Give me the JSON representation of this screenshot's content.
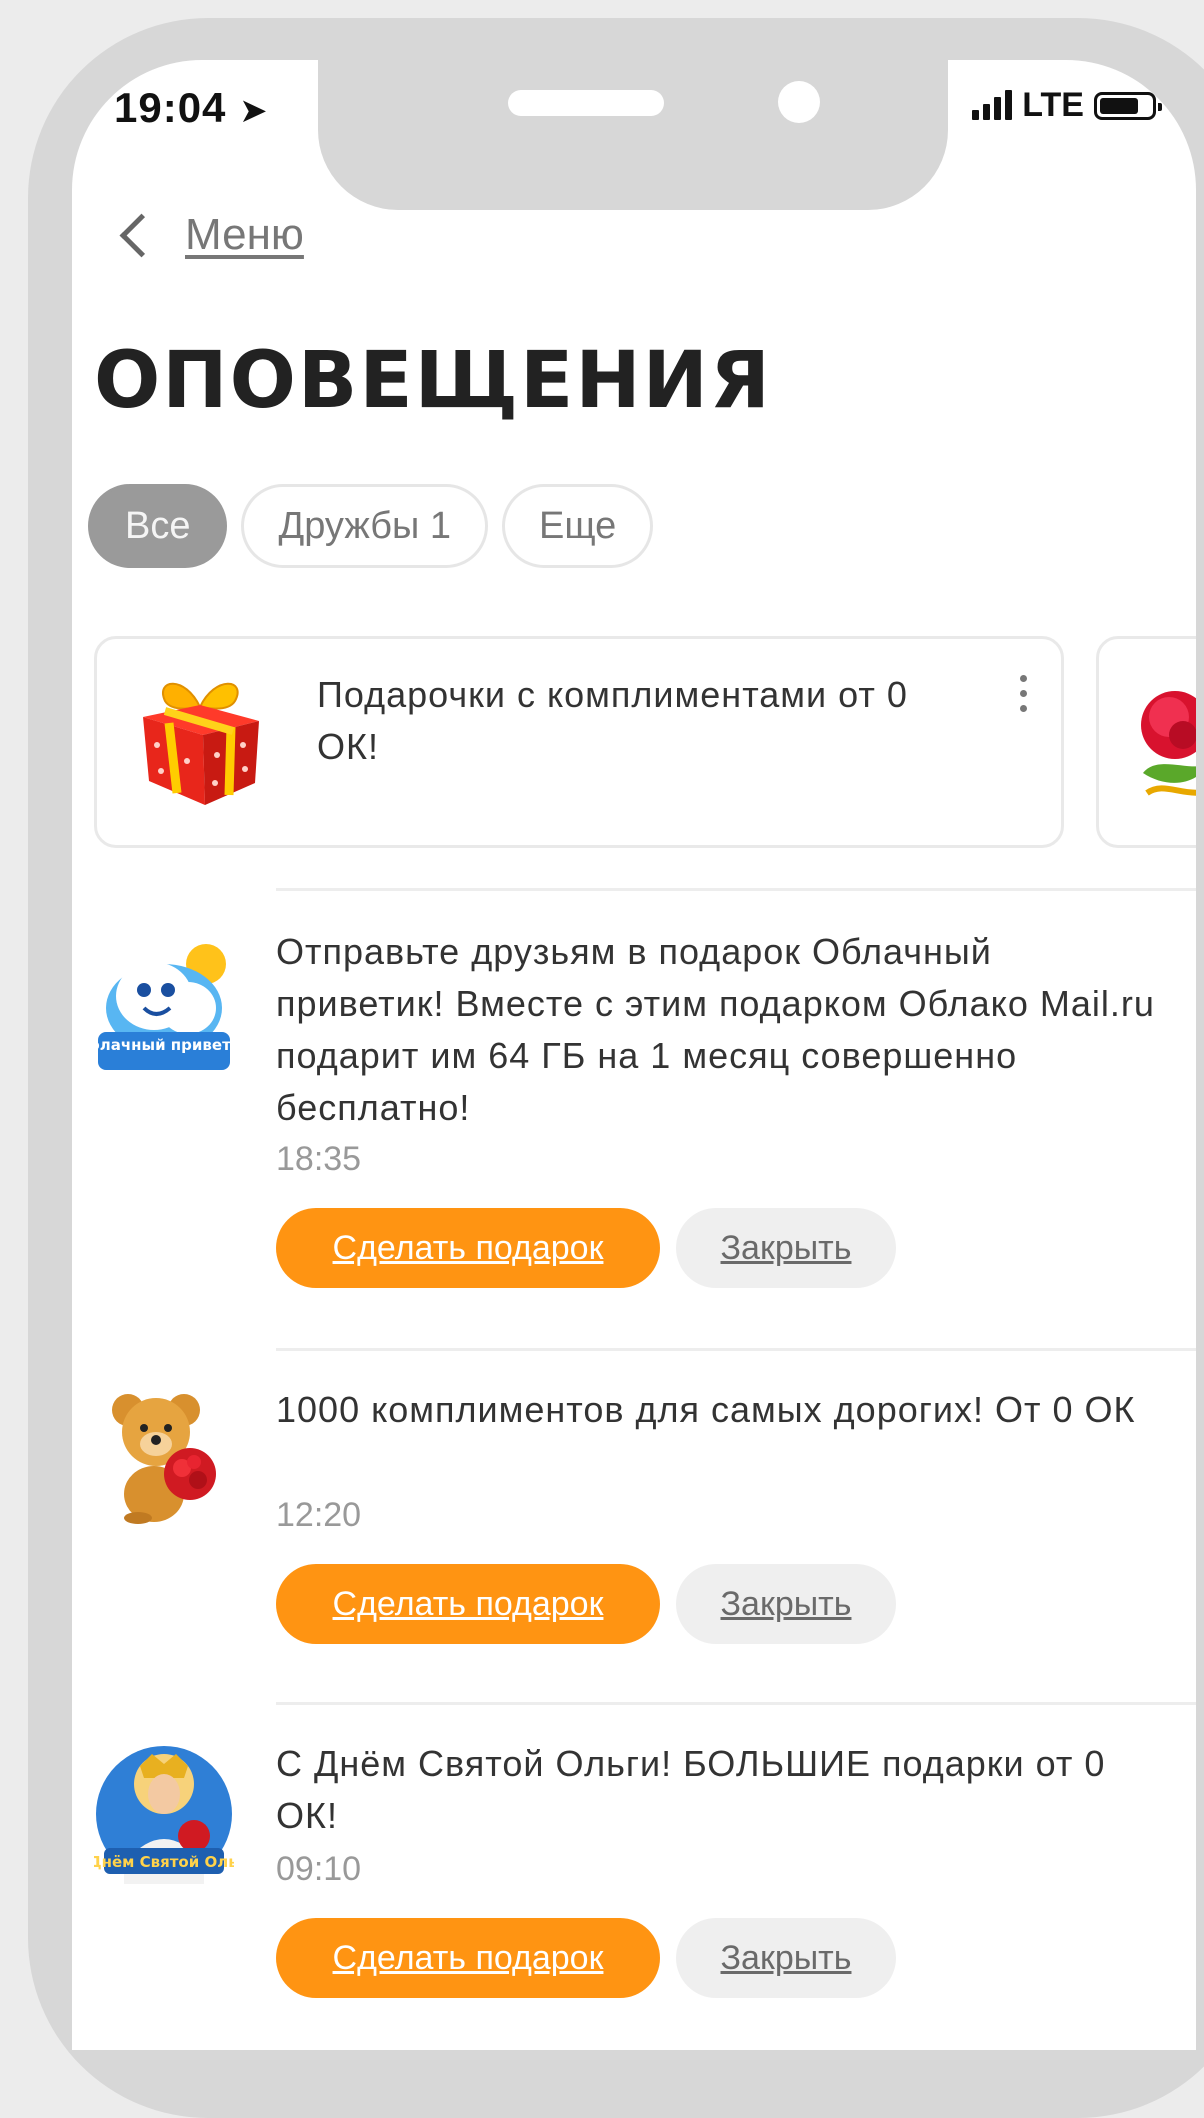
{
  "status_bar": {
    "time": "19:04",
    "network": "LTE"
  },
  "nav": {
    "back_label": "Меню"
  },
  "page": {
    "title": "ОПОВЕЩЕНИЯ"
  },
  "tabs": [
    {
      "label": "Все",
      "active": true
    },
    {
      "label": "Дружбы 1",
      "active": false
    },
    {
      "label": "Еще",
      "active": false
    }
  ],
  "promo_cards": [
    {
      "text": "Подарочки с комплиментами от 0 ОК!",
      "icon": "gift-box-icon"
    },
    {
      "text": "",
      "icon": "rose-icon"
    }
  ],
  "notifications": [
    {
      "text": "Отправьте друзьям в подарок Облачный приветик! Вместе с этим подарком Облако Mail.ru подарит им 64 ГБ на 1 месяц совершенно бесплатно!",
      "time": "18:35",
      "avatar_caption": "Облачный приветик",
      "primary_action": "Сделать подарок",
      "secondary_action": "Закрыть"
    },
    {
      "text": "1000 комплиментов для самых дорогих! От 0 ОК",
      "time": "12:20",
      "avatar_caption": "",
      "primary_action": "Сделать подарок",
      "secondary_action": "Закрыть"
    },
    {
      "text": "С Днём Святой Ольги! БОЛЬШИЕ подарки от 0 ОК!",
      "time": "09:10",
      "avatar_caption": "С Днём Святой Ольги",
      "primary_action": "Сделать подарок",
      "secondary_action": "Закрыть"
    }
  ],
  "colors": {
    "accent": "#ff9412",
    "tab_active": "#9a9a9a",
    "text": "#333333",
    "muted": "#999999"
  }
}
